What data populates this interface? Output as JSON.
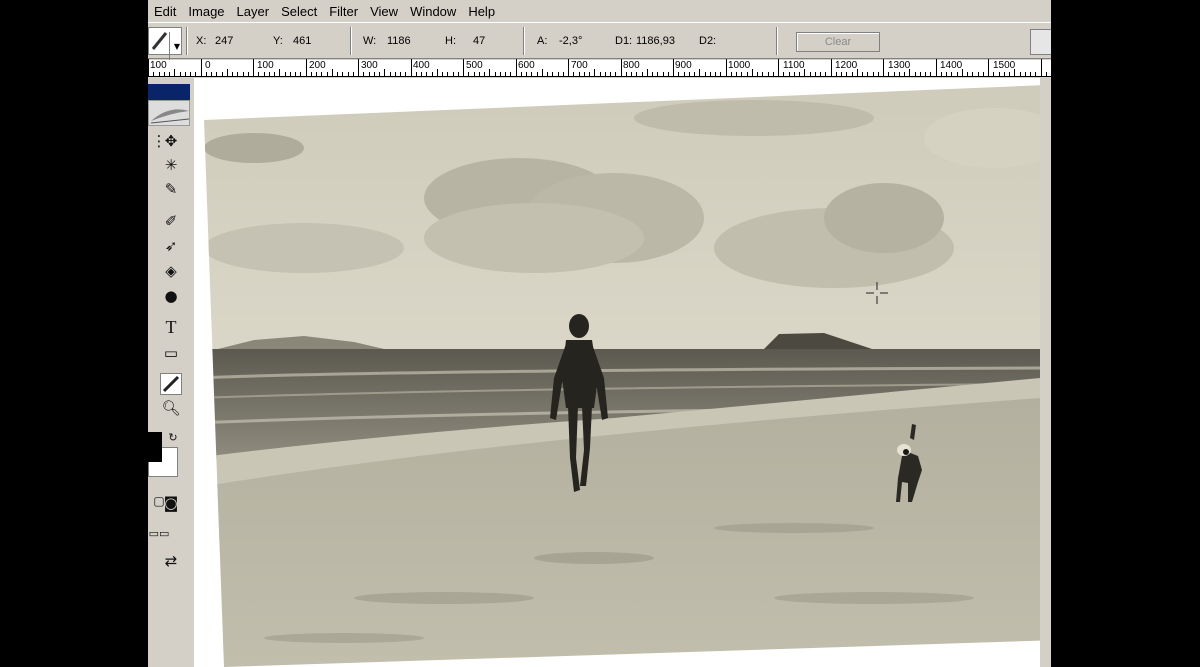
{
  "menubar": {
    "items": [
      "Edit",
      "Image",
      "Layer",
      "Select",
      "Filter",
      "View",
      "Window",
      "Help"
    ]
  },
  "options": {
    "x_label": "X:",
    "x_value": "247",
    "y_label": "Y:",
    "y_value": "461",
    "w_label": "W:",
    "w_value": "1186",
    "h_label": "H:",
    "h_value": "47",
    "a_label": "A:",
    "a_value": "-2,3°",
    "d1_label": "D1:",
    "d1_value": "1186,93",
    "d2_label": "D2:",
    "clear_label": "Clear"
  },
  "ruler": {
    "labels": [
      "100",
      "0",
      "100",
      "200",
      "300",
      "400",
      "500",
      "600",
      "700",
      "800",
      "900",
      "1000",
      "1100",
      "1200",
      "1300",
      "1400",
      "1500"
    ]
  },
  "tools": {
    "icons": [
      "move-icon",
      "magic-wand-icon",
      "slice-icon",
      "brush-icon",
      "history-brush-icon",
      "paint-bucket-icon",
      "burn-icon",
      "type-icon",
      "shape-icon",
      "measure-icon",
      "zoom-icon",
      "swap-colors-icon"
    ],
    "type_glyph": "T"
  },
  "colors": {
    "foreground": "#000000",
    "background": "#ffffff",
    "menu_highlight": "#0a246a"
  }
}
